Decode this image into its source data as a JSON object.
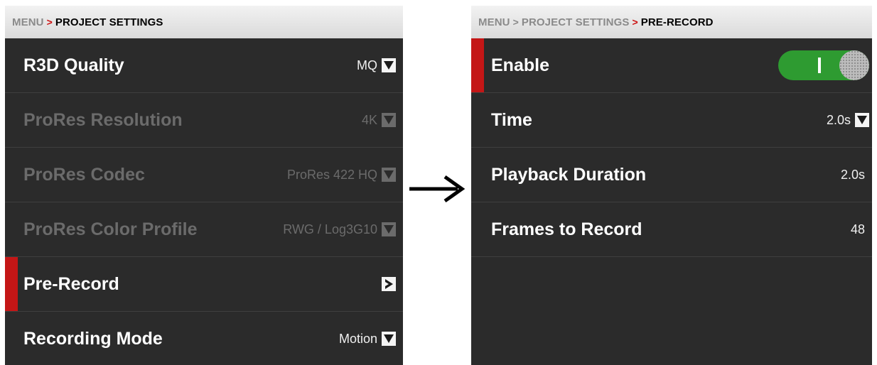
{
  "left_panel": {
    "breadcrumb": {
      "root": "MENU",
      "sep": ">",
      "current": "PROJECT SETTINGS"
    },
    "rows": [
      {
        "label": "R3D Quality",
        "value": "MQ"
      },
      {
        "label": "ProRes Resolution",
        "value": "4K"
      },
      {
        "label": "ProRes Codec",
        "value": "ProRes 422 HQ"
      },
      {
        "label": "ProRes Color Profile",
        "value": "RWG / Log3G10"
      },
      {
        "label": "Pre-Record"
      },
      {
        "label": "Recording Mode",
        "value": "Motion"
      }
    ]
  },
  "right_panel": {
    "breadcrumb": {
      "root": "MENU",
      "sep1": ">",
      "middle": "PROJECT SETTINGS",
      "sep2": ">",
      "current": "PRE-RECORD"
    },
    "rows": [
      {
        "label": "Enable",
        "toggle_on": true
      },
      {
        "label": "Time",
        "value": "2.0s"
      },
      {
        "label": "Playback Duration",
        "value": "2.0s"
      },
      {
        "label": "Frames to Record",
        "value": "48"
      }
    ]
  },
  "colors": {
    "accent": "#c41616",
    "toggle_on": "#2e9b31",
    "panel_bg": "#2b2b2b"
  },
  "icons": {
    "dropdown": "chevron-down-icon",
    "submenu": "chevron-right-icon",
    "transition": "arrow-right-icon"
  }
}
